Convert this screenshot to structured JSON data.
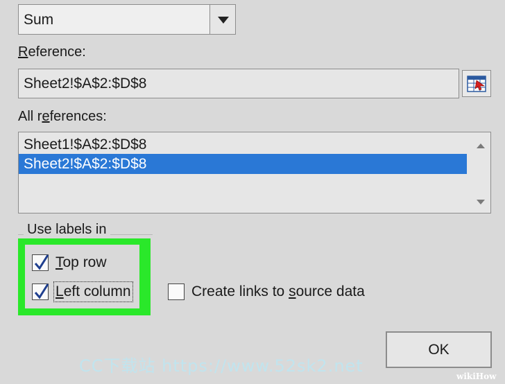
{
  "function": {
    "value": "Sum"
  },
  "reference": {
    "label_letter": "R",
    "label_rest": "eference:",
    "value": "Sheet2!$A$2:$D$8"
  },
  "all_references": {
    "label_pre": "All r",
    "label_letter": "e",
    "label_rest": "ferences:",
    "items": [
      "Sheet1!$A$2:$D$8",
      "Sheet2!$A$2:$D$8"
    ],
    "selected_index": 1
  },
  "use_labels": {
    "title": "Use labels in",
    "top_row": {
      "label_letter": "T",
      "label_rest": "op row",
      "checked": true
    },
    "left_column": {
      "label_letter": "L",
      "label_rest": "eft column",
      "checked": true
    }
  },
  "create_links": {
    "label_pre": "Create links to ",
    "label_letter": "s",
    "label_rest": "ource data",
    "checked": false
  },
  "ok_button": {
    "label": "OK"
  },
  "watermark": {
    "text": "CC下载站 https://www.52sk2.net",
    "brand": "wikiHow"
  },
  "colors": {
    "highlight": "#2ae82a",
    "selection": "#2a78d6",
    "check": "#1f3f8f"
  }
}
